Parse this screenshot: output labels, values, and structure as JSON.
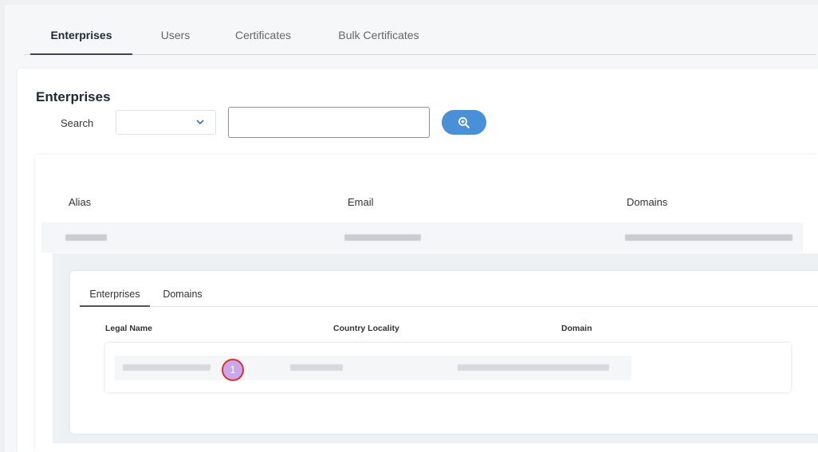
{
  "top_tabs": [
    {
      "label": "Enterprises",
      "active": true
    },
    {
      "label": "Users",
      "active": false
    },
    {
      "label": "Certificates",
      "active": false
    },
    {
      "label": "Bulk Certificates",
      "active": false
    }
  ],
  "section": {
    "title": "Enterprises",
    "search_label": "Search",
    "select_value": "",
    "search_value": "",
    "search_button_icon": "zoom-in-icon"
  },
  "results": {
    "columns": [
      "Alias",
      "Email",
      "Domains"
    ]
  },
  "nested": {
    "tabs": [
      {
        "label": "Enterprises",
        "active": true
      },
      {
        "label": "Domains",
        "active": false
      }
    ],
    "columns": [
      "Legal Name",
      "Country Locality",
      "Domain"
    ],
    "marker_label": "1"
  },
  "colors": {
    "accent": "#4a90d9",
    "marker_border": "#e0312e",
    "marker_fill": "#c9a7e8"
  }
}
